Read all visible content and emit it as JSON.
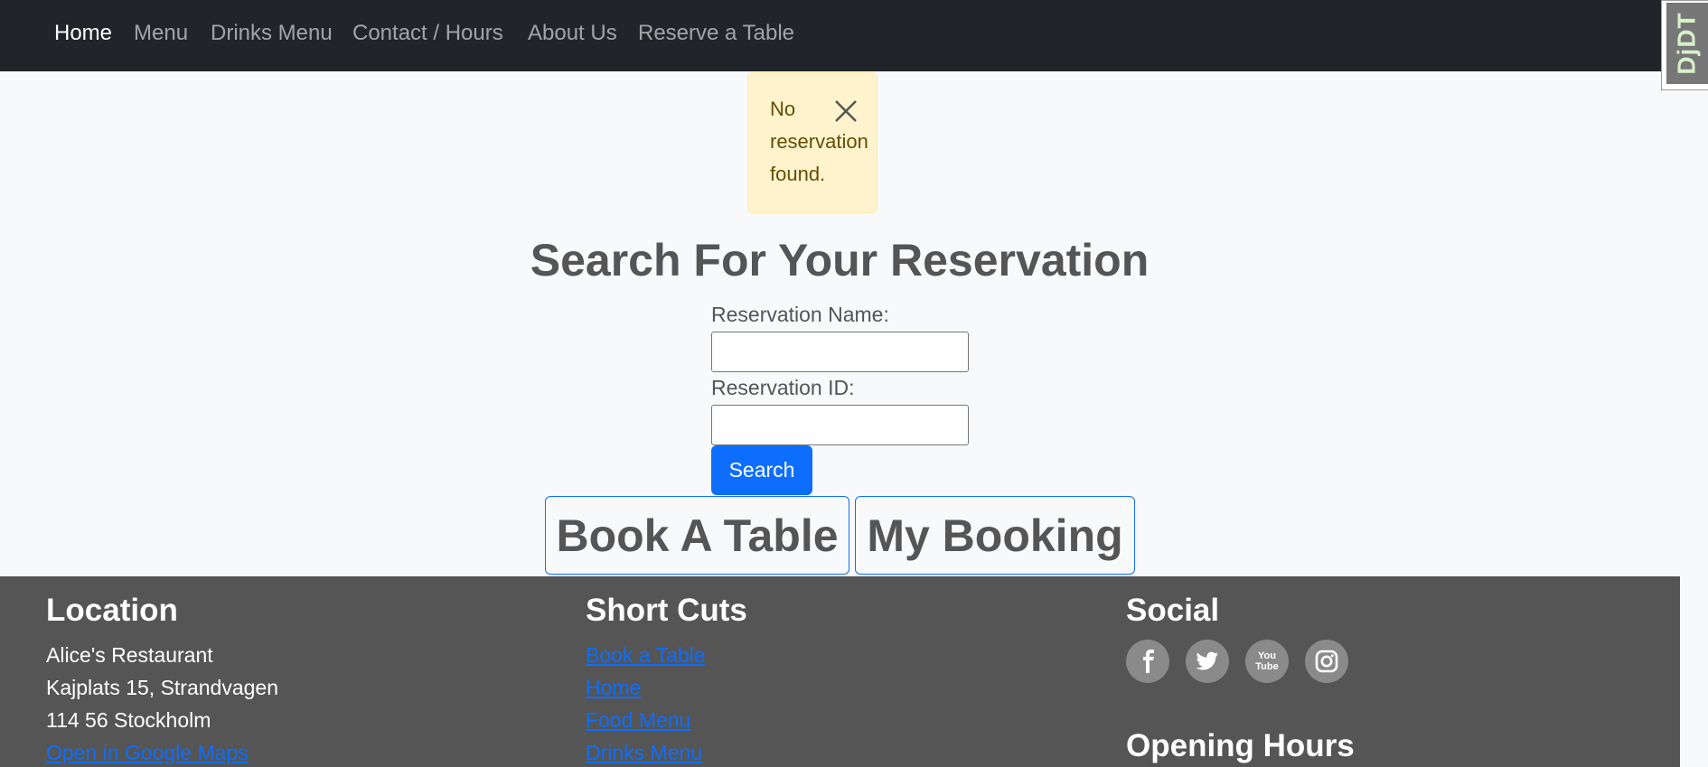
{
  "nav": {
    "items": [
      {
        "label": "Home",
        "active": true
      },
      {
        "label": "Menu"
      },
      {
        "label": "Drinks Menu"
      },
      {
        "label": "Contact / Hours"
      },
      {
        "label": "About Us"
      },
      {
        "label": "Reserve a Table"
      }
    ],
    "debug_toolbar_label": "DjDT"
  },
  "alert": {
    "message": "No reservation found.",
    "close_icon": "close-icon"
  },
  "search": {
    "title": "Search For Your Reservation",
    "name_label": "Reservation Name:",
    "name_value": "",
    "id_label": "Reservation ID:",
    "id_value": "",
    "button_label": "Search"
  },
  "actions": {
    "book_label": "Book A Table",
    "my_booking_label": "My Booking"
  },
  "footer": {
    "location": {
      "heading": "Location",
      "name": "Alice's Restaurant",
      "street": "Kajplats 15, Strandvagen",
      "city": "114 56 Stockholm",
      "maps_link": "Open in Google Maps"
    },
    "shortcuts": {
      "heading": "Short Cuts",
      "links": [
        "Book a Table",
        "Home",
        "Food Menu",
        "Drinks Menu"
      ]
    },
    "social": {
      "heading": "Social",
      "icons": [
        "facebook-icon",
        "twitter-icon",
        "youtube-icon",
        "instagram-icon"
      ],
      "youtube_text": "You Tube"
    },
    "hours": {
      "heading": "Opening Hours"
    }
  },
  "colors": {
    "navbar": "#212529",
    "primary": "#0d6efd",
    "alert_bg": "#fff3cd",
    "footer_bg": "#555555"
  }
}
